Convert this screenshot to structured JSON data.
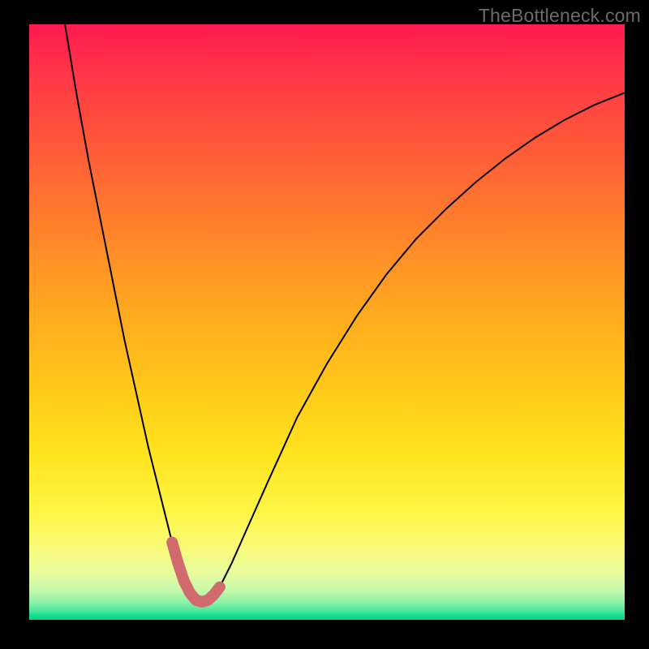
{
  "watermark": "TheBottleneck.com",
  "chart_data": {
    "type": "line",
    "title": "",
    "xlabel": "",
    "ylabel": "",
    "xlim": [
      0,
      100
    ],
    "ylim": [
      0,
      100
    ],
    "grid": false,
    "legend": false,
    "annotations": [],
    "series": [
      {
        "name": "bottleneck-curve",
        "color": "#000000",
        "stroke_width": 2,
        "x": [
          6,
          8,
          10,
          12,
          14,
          16,
          18,
          20,
          22,
          24,
          25,
          26,
          27,
          28,
          29,
          30,
          32,
          34,
          36,
          40,
          45,
          50,
          55,
          60,
          65,
          70,
          75,
          80,
          85,
          90,
          95,
          100
        ],
        "y": [
          100,
          88,
          77,
          67,
          57,
          47,
          38,
          29,
          21,
          13,
          9.5,
          6.5,
          4.5,
          3.3,
          3.0,
          3.3,
          5.5,
          9.5,
          14,
          23,
          34,
          43,
          51,
          58,
          64,
          69,
          73.5,
          77.5,
          81,
          84,
          86.5,
          88.5
        ]
      },
      {
        "name": "optimal-marker",
        "color": "#d16a6f",
        "stroke_width": 14,
        "linecap": "round",
        "x": [
          24,
          25,
          26,
          27,
          28,
          29,
          30,
          31,
          32
        ],
        "y": [
          13,
          9.5,
          6.5,
          4.5,
          3.3,
          3.0,
          3.3,
          4.2,
          5.5
        ]
      }
    ],
    "gradient": {
      "top": "#ff1a50",
      "mid_upper": "#ff9824",
      "mid": "#ffe31e",
      "lower": "#c6f8ab",
      "bottom": "#06d184"
    }
  }
}
